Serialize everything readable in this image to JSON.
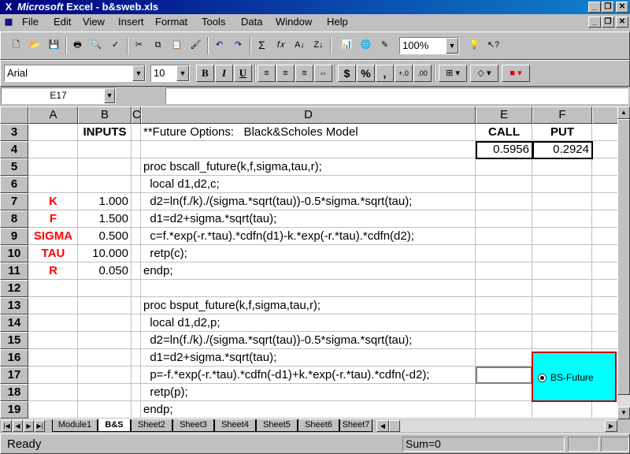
{
  "window": {
    "app_name": "Microsoft",
    "title_rest": " Excel - b&sweb.xls",
    "controls": [
      "_",
      "❐",
      "✕"
    ]
  },
  "menu": {
    "items": [
      {
        "label": "File"
      },
      {
        "label": "Edit"
      },
      {
        "label": "View"
      },
      {
        "label": "Insert"
      },
      {
        "label": "Format"
      },
      {
        "label": "Tools"
      },
      {
        "label": "Data"
      },
      {
        "label": "Window"
      },
      {
        "label": "Help"
      }
    ]
  },
  "standard_toolbar": {
    "zoom": "100%"
  },
  "formatting_toolbar": {
    "font": "Arial",
    "font_size": "10",
    "bold": "B",
    "italic": "I",
    "underline": "U",
    "currency": "$",
    "percent": "%",
    "comma": ",",
    "increase_decimal": "+.0",
    "decrease_decimal": ".00"
  },
  "formula_bar": {
    "name_box": "E17",
    "formula": ""
  },
  "columns": [
    "A",
    "B",
    "C",
    "D",
    "E",
    "F"
  ],
  "rows": [
    {
      "num": "3",
      "A": "",
      "B": "INPUTS",
      "D": "**Future Options:   Black&Scholes Model",
      "E": "CALL",
      "F": "PUT"
    },
    {
      "num": "4",
      "A": "",
      "B": "",
      "D": "",
      "E": "0.5956",
      "F": "0.2924"
    },
    {
      "num": "5",
      "A": "",
      "B": "",
      "D": "proc bscall_future(k,f,sigma,tau,r);",
      "E": "",
      "F": ""
    },
    {
      "num": "6",
      "A": "",
      "B": "",
      "D": "  local d1,d2,c;",
      "E": "",
      "F": ""
    },
    {
      "num": "7",
      "A": "K",
      "B": "1.000",
      "D": "  d2=ln(f./k)./(sigma.*sqrt(tau))-0.5*sigma.*sqrt(tau);",
      "E": "",
      "F": ""
    },
    {
      "num": "8",
      "A": "F",
      "B": "1.500",
      "D": "  d1=d2+sigma.*sqrt(tau);",
      "E": "",
      "F": ""
    },
    {
      "num": "9",
      "A": "SIGMA",
      "B": "0.500",
      "D": "  c=f.*exp(-r.*tau).*cdfn(d1)-k.*exp(-r.*tau).*cdfn(d2);",
      "E": "",
      "F": ""
    },
    {
      "num": "10",
      "A": "TAU",
      "B": "10.000",
      "D": "  retp(c);",
      "E": "",
      "F": ""
    },
    {
      "num": "11",
      "A": "R",
      "B": "0.050",
      "D": "endp;",
      "E": "",
      "F": ""
    },
    {
      "num": "12",
      "A": "",
      "B": "",
      "D": "",
      "E": "",
      "F": ""
    },
    {
      "num": "13",
      "A": "",
      "B": "",
      "D": "proc bsput_future(k,f,sigma,tau,r);",
      "E": "",
      "F": ""
    },
    {
      "num": "14",
      "A": "",
      "B": "",
      "D": "  local d1,d2,p;",
      "E": "",
      "F": ""
    },
    {
      "num": "15",
      "A": "",
      "B": "",
      "D": "  d2=ln(f./k)./(sigma.*sqrt(tau))-0.5*sigma.*sqrt(tau);",
      "E": "",
      "F": ""
    },
    {
      "num": "16",
      "A": "",
      "B": "",
      "D": "  d1=d2+sigma.*sqrt(tau);",
      "E": "",
      "F": ""
    },
    {
      "num": "17",
      "A": "",
      "B": "",
      "D": "  p=-f.*exp(-r.*tau).*cdfn(-d1)+k.*exp(-r.*tau).*cdfn(-d2);",
      "E": "",
      "F": ""
    },
    {
      "num": "18",
      "A": "",
      "B": "",
      "D": "  retp(p);",
      "E": "",
      "F": ""
    },
    {
      "num": "19",
      "A": "",
      "B": "",
      "D": "endp;",
      "E": "",
      "F": ""
    }
  ],
  "option_button": {
    "label": "BS-Future",
    "selected": true,
    "background": "#00ffff",
    "border": "#c00000"
  },
  "sheet_tabs": [
    {
      "label": "Module1",
      "active": false
    },
    {
      "label": "B&S",
      "active": true
    },
    {
      "label": "Sheet2",
      "active": false
    },
    {
      "label": "Sheet3",
      "active": false
    },
    {
      "label": "Sheet4",
      "active": false
    },
    {
      "label": "Sheet5",
      "active": false
    },
    {
      "label": "Sheet6",
      "active": false
    },
    {
      "label": "Sheet7",
      "active": false
    }
  ],
  "status": {
    "text": "Ready",
    "sum": "Sum=0"
  },
  "colors": {
    "title_bar": "#000080",
    "input_labels": "#ff0000",
    "face": "#c0c0c0"
  }
}
